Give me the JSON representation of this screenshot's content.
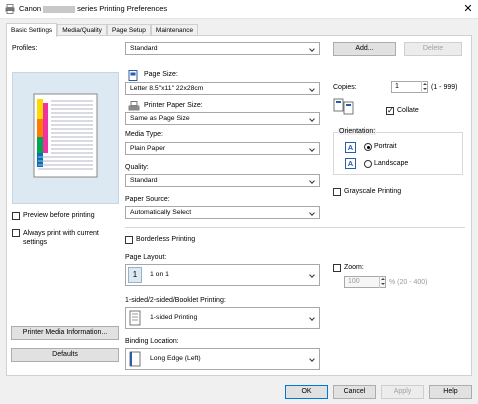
{
  "window": {
    "title_prefix": "Canon",
    "title_suffix": "series Printing Preferences",
    "close_glyph": "✕"
  },
  "tabs": [
    {
      "label": "Basic Settings",
      "active": true
    },
    {
      "label": "Media/Quality",
      "active": false
    },
    {
      "label": "Page Setup",
      "active": false
    },
    {
      "label": "Maintenance",
      "active": false
    }
  ],
  "profiles": {
    "label": "Profiles:",
    "value": "Standard",
    "add_label": "Add...",
    "delete_label": "Delete"
  },
  "preview": {
    "preview_before_printing": "Preview before printing",
    "always_print_current": "Always print with current settings",
    "printer_media_info": "Printer Media Information...",
    "defaults": "Defaults"
  },
  "page_size": {
    "label": "Page Size:",
    "value": "Letter 8.5\"x11\" 22x28cm"
  },
  "printer_paper_size": {
    "label": "Printer Paper Size:",
    "value": "Same as Page Size"
  },
  "media_type": {
    "label": "Media Type:",
    "value": "Plain Paper"
  },
  "quality": {
    "label": "Quality:",
    "value": "Standard"
  },
  "paper_source": {
    "label": "Paper Source:",
    "value": "Automatically Select"
  },
  "copies": {
    "label": "Copies:",
    "value": "1",
    "range": "(1 - 999)",
    "collate": "Collate"
  },
  "orientation": {
    "label": "Orientation:",
    "portrait": "Portrait",
    "landscape": "Landscape",
    "portrait_icon": "A",
    "landscape_icon": "A"
  },
  "grayscale": "Grayscale Printing",
  "borderless": "Borderless Printing",
  "page_layout": {
    "label": "Page Layout:",
    "icon_text": "1",
    "value": "1 on 1"
  },
  "zoom": {
    "label": "Zoom:",
    "value": "100",
    "range": "% (20 - 400)"
  },
  "duplex": {
    "label": "1-sided/2-sided/Booklet Printing:",
    "value": "1-sided Printing"
  },
  "binding": {
    "label": "Binding Location:",
    "value": "Long Edge (Left)"
  },
  "footer": {
    "ok": "OK",
    "cancel": "Cancel",
    "apply": "Apply",
    "help": "Help"
  },
  "colors": {
    "accent": "#0078d7"
  }
}
